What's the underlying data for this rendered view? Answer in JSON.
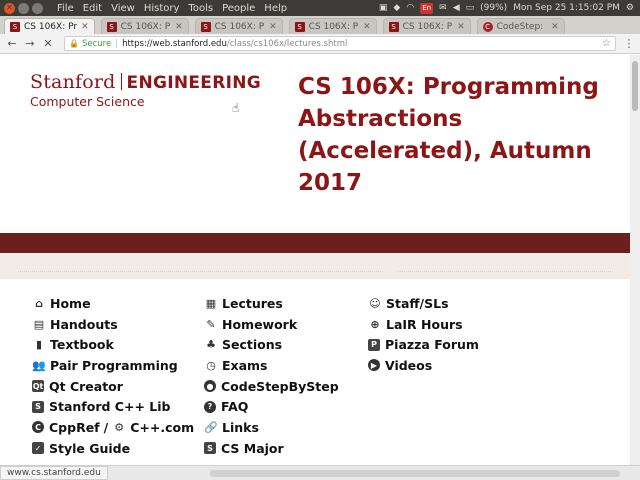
{
  "os": {
    "menus": [
      "File",
      "Edit",
      "View",
      "History",
      "Tools",
      "People",
      "Help"
    ],
    "battery": "(99%)",
    "clock": "Mon Sep 25  1:15:02 PM",
    "close_glyph": "✕"
  },
  "tabs": [
    {
      "label": "CS 106X: Pr",
      "favicon": "S",
      "active": true
    },
    {
      "label": "CS 106X: P",
      "favicon": "S",
      "active": false
    },
    {
      "label": "CS 106X: P",
      "favicon": "S",
      "active": false
    },
    {
      "label": "CS 106X: P",
      "favicon": "S",
      "active": false
    },
    {
      "label": "CS 106X: P",
      "favicon": "S",
      "active": false
    },
    {
      "label": "CodeStep:",
      "favicon": "C",
      "active": false
    }
  ],
  "address": {
    "secure_label": "Secure",
    "host": "https://web.stanford.edu",
    "path": "/class/cs106x/lectures.shtml"
  },
  "logo": {
    "stanford": "Stanford",
    "engineering": "ENGINEERING",
    "department": "Computer Science"
  },
  "course_title": "CS 106X: Programming Abstractions (Accelerated), Autumn 2017",
  "nav": {
    "col1": [
      {
        "label": "Home",
        "icon": "home-icon",
        "glyph": "⌂"
      },
      {
        "label": "Handouts",
        "icon": "handouts-icon",
        "glyph": "▤"
      },
      {
        "label": "Textbook",
        "icon": "book-icon",
        "glyph": "▮"
      },
      {
        "label": "Pair Programming",
        "icon": "users-icon",
        "glyph": "👥"
      },
      {
        "label": "Qt Creator",
        "icon": "qt-icon",
        "glyph": "Qt"
      },
      {
        "label": "Stanford C++ Lib",
        "icon": "stanford-lib-icon",
        "glyph": "S"
      },
      {
        "label": "CppRef",
        "label2": "C++.com",
        "icon": "cppref-icon",
        "icon2": "cplusplus-icon",
        "glyph": "C",
        "glyph2": "⚙"
      },
      {
        "label": "Style Guide",
        "icon": "check-icon",
        "glyph": "✓"
      }
    ],
    "col2": [
      {
        "label": "Lectures",
        "icon": "calendar-icon",
        "glyph": "▦"
      },
      {
        "label": "Homework",
        "icon": "edit-icon",
        "glyph": "✎"
      },
      {
        "label": "Sections",
        "icon": "tree-icon",
        "glyph": "♣"
      },
      {
        "label": "Exams",
        "icon": "clock-icon",
        "glyph": "◷"
      },
      {
        "label": "CodeStepByStep",
        "icon": "codestep-icon",
        "glyph": "●"
      },
      {
        "label": "FAQ",
        "icon": "question-icon",
        "glyph": "?"
      },
      {
        "label": "Links",
        "icon": "link-icon",
        "glyph": "🔗"
      },
      {
        "label": "CS Major",
        "icon": "cs-major-icon",
        "glyph": "S"
      }
    ],
    "col3": [
      {
        "label": "Staff/SLs",
        "icon": "smile-icon",
        "glyph": "☺"
      },
      {
        "label": "LaIR Hours",
        "icon": "lifebuoy-icon",
        "glyph": "⊕"
      },
      {
        "label": "Piazza Forum",
        "icon": "piazza-icon",
        "glyph": "P"
      },
      {
        "label": "Videos",
        "icon": "play-icon",
        "glyph": "▶"
      }
    ]
  },
  "status_url": "www.cs.stanford.edu",
  "colors": {
    "cardinal": "#8c1515",
    "band": "#6d1f1e"
  }
}
